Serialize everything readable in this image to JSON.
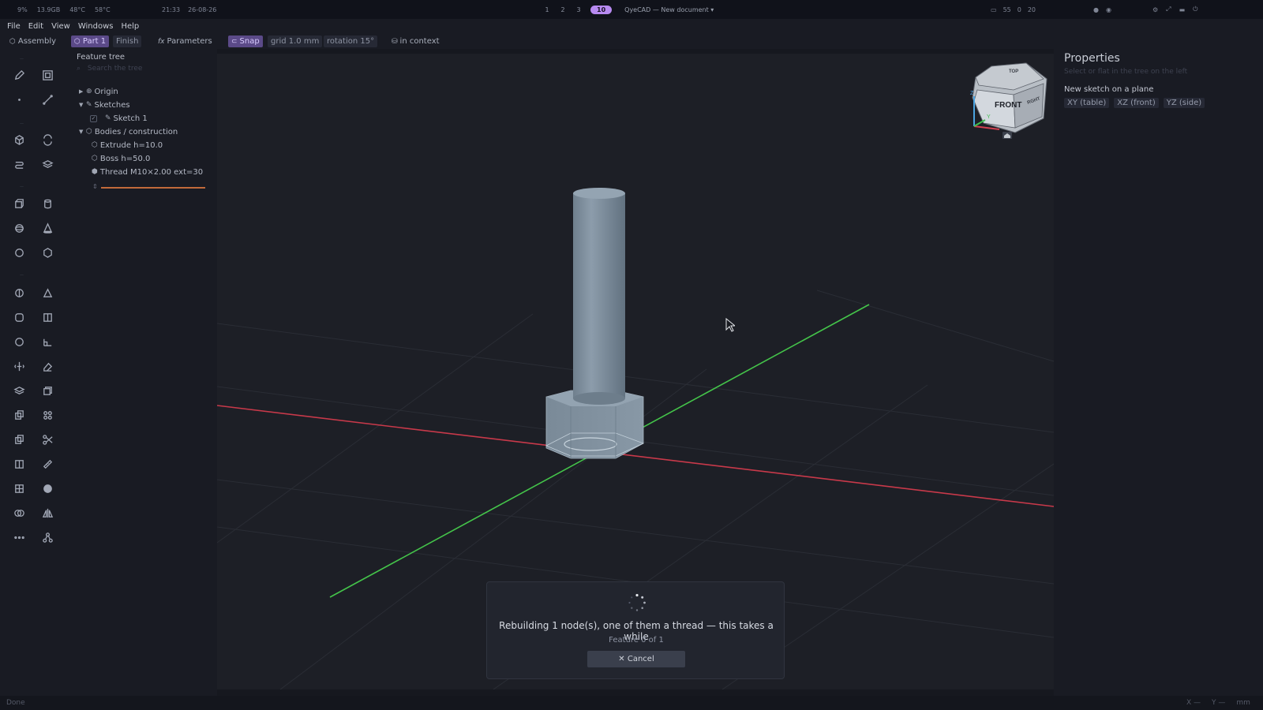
{
  "topbar": {
    "stats": [
      "9%",
      "13.9GB",
      "48°C",
      "58°C"
    ],
    "time": "21:33",
    "date": "26-08-26",
    "workspaces": [
      "1",
      "2",
      "3"
    ],
    "active_workspace": "10",
    "document": "QyeCAD — New document ▾",
    "right": [
      "55",
      "0",
      "20"
    ]
  },
  "menu": {
    "file": "File",
    "edit": "Edit",
    "view": "View",
    "windows": "Windows",
    "help": "Help"
  },
  "toolbar": {
    "assembly": "Assembly",
    "part": "Part 1",
    "finish": "Finish",
    "parameters": "Parameters",
    "snap": "Snap",
    "grid": "grid 1.0 mm",
    "rotation": "rotation 15°",
    "in_context": "in context"
  },
  "tree": {
    "title": "Feature tree",
    "search_placeholder": "Search the tree",
    "origin": "Origin",
    "sketches": "Sketches",
    "sketch1": "Sketch 1",
    "bodies": "Bodies / construction",
    "extrude": "Extrude h=10.0",
    "boss": "Boss h=50.0",
    "thread": "Thread M10×2.00 ext=30"
  },
  "properties": {
    "title": "Properties",
    "subtitle": "Select or flat in the tree on the left",
    "new_sketch_label": "New sketch on a plane",
    "planes": [
      "XY (table)",
      "XZ (front)",
      "YZ (side)"
    ]
  },
  "viewcube": {
    "front": "FRONT",
    "top": "TOP",
    "right": "RGHT",
    "z_label": "Z",
    "y_label": "Y"
  },
  "dialog": {
    "message": "Rebuilding 1 node(s), one of them a thread — this takes a while",
    "count": "Feature 0 of 1",
    "cancel": "✕ Cancel"
  },
  "status": {
    "left": "Done",
    "x": "X —",
    "y": "Y —",
    "units": "mm"
  },
  "colors": {
    "x_axis": "#c8394a",
    "y_axis": "#44c44a",
    "accent": "#b78af0",
    "model": "#7d8d9b"
  }
}
